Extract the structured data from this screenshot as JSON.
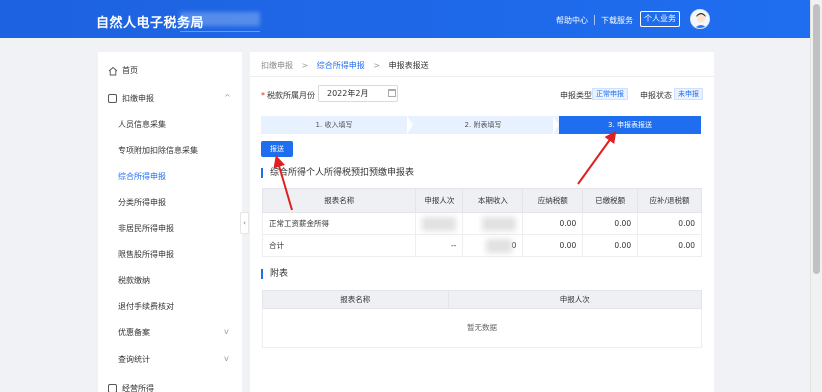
{
  "header": {
    "title": "自然人电子税务局",
    "links": {
      "help": "帮助中心",
      "download": "下载服务"
    },
    "personal_button": "个人业务",
    "colors": {
      "primary": "#1f6ef0"
    }
  },
  "sidebar": {
    "items": [
      {
        "label": "首页",
        "icon": "home-icon"
      },
      {
        "label": "扣缴申报",
        "icon": "form-icon",
        "arrow": "^"
      },
      {
        "label": "人员信息采集"
      },
      {
        "label": "专项附加扣除信息采集"
      },
      {
        "label": "综合所得申报",
        "active": true
      },
      {
        "label": "分类所得申报"
      },
      {
        "label": "非居民所得申报"
      },
      {
        "label": "限售股所得申报"
      },
      {
        "label": "税款缴纳"
      },
      {
        "label": "退付手续费核对"
      },
      {
        "label": "优惠备案",
        "arrow": "v"
      },
      {
        "label": "查询统计",
        "arrow": "v"
      },
      {
        "label": "经营所得",
        "icon": "folder-icon"
      }
    ]
  },
  "breadcrumb": {
    "item1": "扣缴申报",
    "item2": "综合所得申报",
    "item3": "申报表报送",
    "sep": ">"
  },
  "form": {
    "period_label": "税款所属月份",
    "period_value": "2022年2月",
    "type_label": "申报类型",
    "type_value": "正常申报",
    "status_label": "申报状态",
    "status_value": "未申报"
  },
  "steps": [
    "1. 收入填写",
    "2. 附表填写",
    "3. 申报表报送"
  ],
  "submit_button": "报送",
  "section1": {
    "title": "综合所得个人所得税预扣预缴申报表",
    "columns": [
      "报表名称",
      "申报人次",
      "本期收入",
      "应纳税额",
      "已缴税额",
      "应补/退税额"
    ],
    "rows": [
      {
        "name": "正常工资薪金所得",
        "count": "",
        "income": "",
        "tax_payable": "0.00",
        "tax_paid": "0.00",
        "refund": "0.00"
      },
      {
        "name": "合计",
        "count": "--",
        "income": "0",
        "tax_payable": "0.00",
        "tax_paid": "0.00",
        "refund": "0.00"
      }
    ]
  },
  "section2": {
    "title": "附表",
    "columns": [
      "报表名称",
      "申报人次"
    ],
    "empty_text": "暂无数据"
  }
}
